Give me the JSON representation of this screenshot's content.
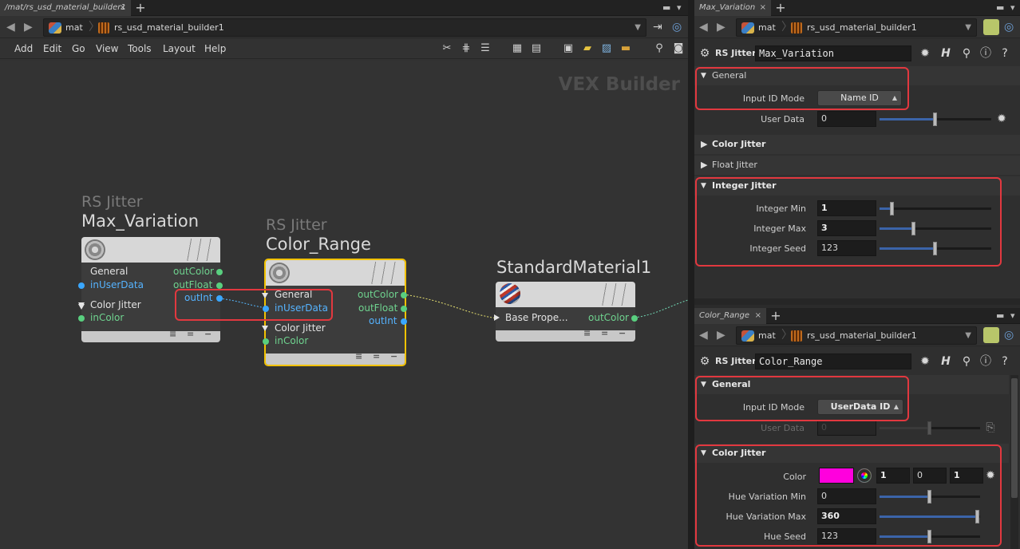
{
  "left": {
    "tab_path": "/mat/rs_usd_material_builder1",
    "crumbs": [
      "mat",
      "rs_usd_material_builder1"
    ],
    "menu": [
      "Add",
      "Edit",
      "Go",
      "View",
      "Tools",
      "Layout",
      "Help"
    ],
    "context_label": "VEX Builder",
    "nodes": {
      "max_variation": {
        "type": "RS Jitter",
        "name": "Max_Variation",
        "inputs": [
          "General",
          "inUserData",
          "Color Jitter",
          "inColor"
        ],
        "outputs": [
          "outColor",
          "outFloat",
          "outInt"
        ]
      },
      "color_range": {
        "type": "RS Jitter",
        "name": "Color_Range",
        "inputs": [
          "General",
          "inUserData",
          "Color Jitter",
          "inColor"
        ],
        "outputs": [
          "outColor",
          "outFloat",
          "outInt"
        ]
      },
      "standard_material": {
        "name": "StandardMaterial1",
        "input": "Base Prope...",
        "output": "outColor"
      }
    }
  },
  "top_pane": {
    "tab_title": "Max_Variation",
    "crumbs": [
      "mat",
      "rs_usd_material_builder1"
    ],
    "node_type": "RS Jitter",
    "node_name": "Max_Variation",
    "general": {
      "label": "General",
      "input_id_mode_label": "Input ID Mode",
      "input_id_mode_value": "Name ID",
      "user_data_label": "User Data",
      "user_data_value": "0",
      "user_data_level": 0.5
    },
    "color_jitter_label": "Color Jitter",
    "float_jitter_label": "Float Jitter",
    "integer_jitter": {
      "label": "Integer Jitter",
      "min_label": "Integer Min",
      "min_value": "1",
      "min_level": 0.1,
      "max_label": "Integer Max",
      "max_value": "3",
      "max_level": 0.3,
      "seed_label": "Integer Seed",
      "seed_value": "123",
      "seed_level": 0.5
    }
  },
  "bottom_pane": {
    "tab_title": "Color_Range",
    "crumbs": [
      "mat",
      "rs_usd_material_builder1"
    ],
    "node_type": "RS Jitter",
    "node_name": "Color_Range",
    "general": {
      "label": "General",
      "input_id_mode_label": "Input ID Mode",
      "input_id_mode_value": "UserData ID",
      "user_data_label": "User Data",
      "user_data_value": "0",
      "user_data_level": 0.5
    },
    "color_jitter": {
      "label": "Color Jitter",
      "color_label": "Color",
      "color_hex": "#ff00dd",
      "color_r": "1",
      "color_g": "0",
      "color_b": "1",
      "hue_min_label": "Hue Variation Min",
      "hue_min_value": "0",
      "hue_min_level": 0.5,
      "hue_max_label": "Hue Variation Max",
      "hue_max_value": "360",
      "hue_max_level": 1.0,
      "hue_seed_label": "Hue Seed",
      "hue_seed_value": "123",
      "hue_seed_level": 0.5
    }
  },
  "colors": {
    "highlight": "#e2383f",
    "selected_node": "#f2c200",
    "port_blue": "#3aa7ff",
    "port_green": "#59cf7f"
  }
}
